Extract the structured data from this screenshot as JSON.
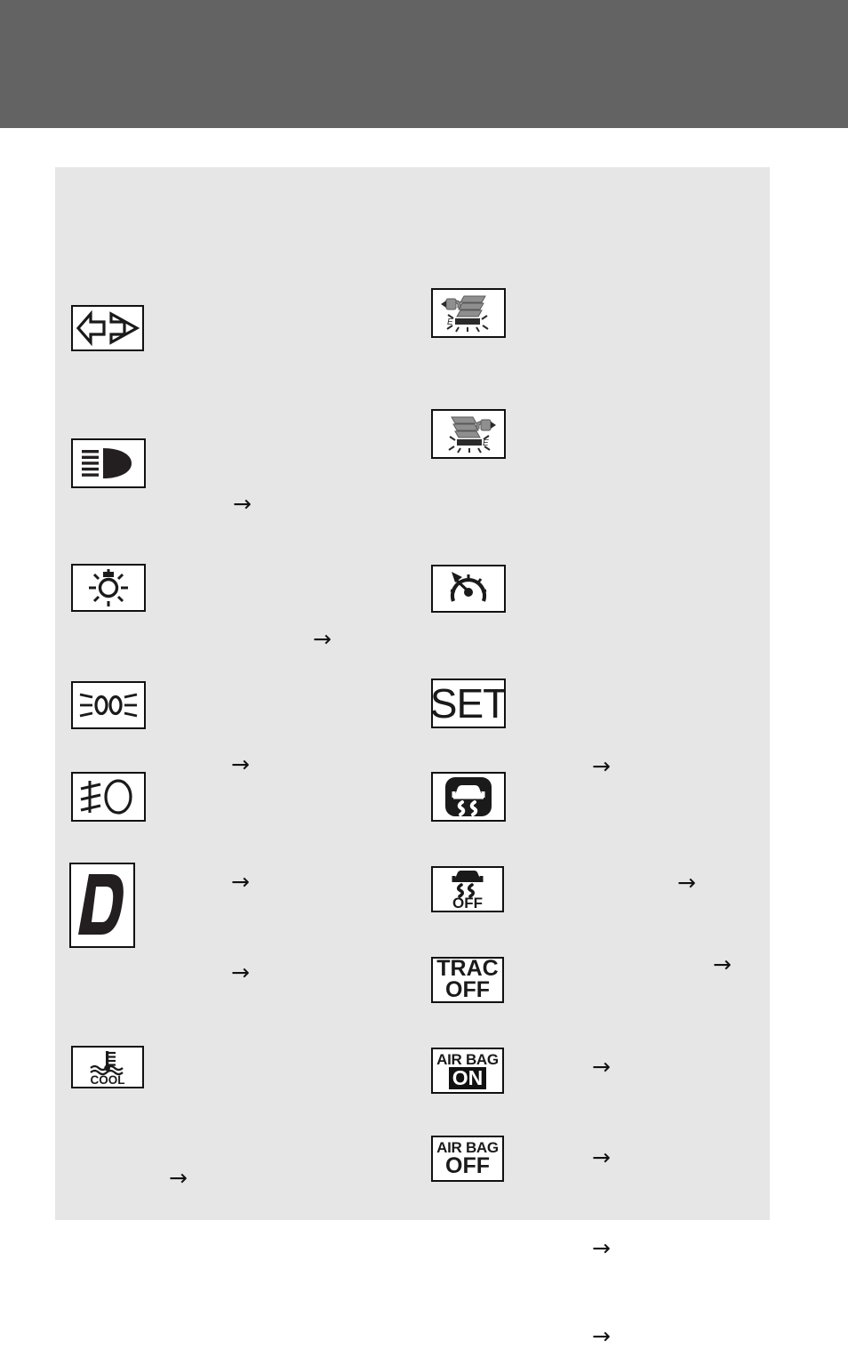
{
  "page": {
    "background_color": "#ffffff",
    "header_color": "#636363",
    "panel_color": "#e6e6e6",
    "ink_color": "#111111"
  },
  "left_column": {
    "items": [
      {
        "icon": "turn-signal-indicator-icon",
        "label": "",
        "arrow": "→"
      },
      {
        "icon": "high-beam-indicator-icon",
        "label": "",
        "arrow": "→"
      },
      {
        "icon": "headlight-indicator-icon",
        "label": "",
        "arrow": "→"
      },
      {
        "icon": "tail-light-indicator-icon",
        "label": "",
        "arrow": "→"
      },
      {
        "icon": "front-fog-light-indicator-icon",
        "label": "",
        "arrow": "→"
      },
      {
        "icon": "drive-mode-d-indicator-icon",
        "label": "D",
        "arrow": "→"
      },
      {
        "icon": "low-coolant-temperature-indicator-icon",
        "label": "COOL",
        "arrow": ""
      }
    ]
  },
  "right_column": {
    "items": [
      {
        "icon": "driver-seat-belt-reminder-icon",
        "label": "",
        "arrow": ""
      },
      {
        "icon": "passenger-seat-belt-reminder-icon",
        "label": "",
        "arrow": ""
      },
      {
        "icon": "cruise-control-indicator-icon",
        "label": "",
        "arrow": "→"
      },
      {
        "icon": "cruise-set-indicator-icon",
        "label": "SET",
        "arrow": "→"
      },
      {
        "icon": "slip-indicator-icon",
        "label": "",
        "arrow": "→"
      },
      {
        "icon": "vsc-off-indicator-icon",
        "label": "OFF",
        "arrow": "→"
      },
      {
        "icon": "trac-off-indicator-icon",
        "label_line1": "TRAC",
        "label_line2": "OFF",
        "arrow": "→"
      },
      {
        "icon": "air-bag-on-indicator-icon",
        "label_line1": "AIR BAG",
        "label_line2": "ON",
        "arrow": "→"
      },
      {
        "icon": "air-bag-off-indicator-icon",
        "label_line1": "AIR BAG",
        "label_line2": "OFF",
        "arrow": "→"
      }
    ]
  }
}
